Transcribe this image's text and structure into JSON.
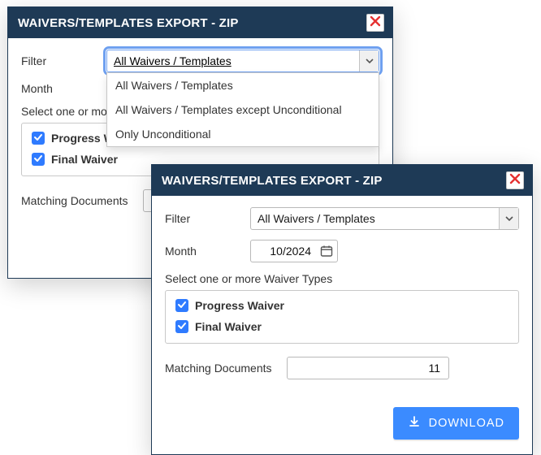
{
  "dialogA": {
    "title": "WAIVERS/TEMPLATES EXPORT - ZIP",
    "filter_label": "Filter",
    "filter_value": "All Waivers / Templates",
    "filter_options": [
      "All Waivers / Templates",
      "All Waivers / Templates except Unconditional",
      "Only Unconditional"
    ],
    "month_label": "Month",
    "select_label": "Select one or more",
    "types": {
      "progress": "Progress Waiver",
      "final": "Final Waiver"
    },
    "matching_label": "Matching Documents"
  },
  "dialogB": {
    "title": "WAIVERS/TEMPLATES EXPORT - ZIP",
    "filter_label": "Filter",
    "filter_value": "All Waivers / Templates",
    "month_label": "Month",
    "month_value": "10/2024",
    "select_label": "Select one or more Waiver Types",
    "types": {
      "progress": "Progress Waiver",
      "final": "Final Waiver"
    },
    "matching_label": "Matching Documents",
    "matching_value": "11",
    "download_label": "DOWNLOAD"
  }
}
